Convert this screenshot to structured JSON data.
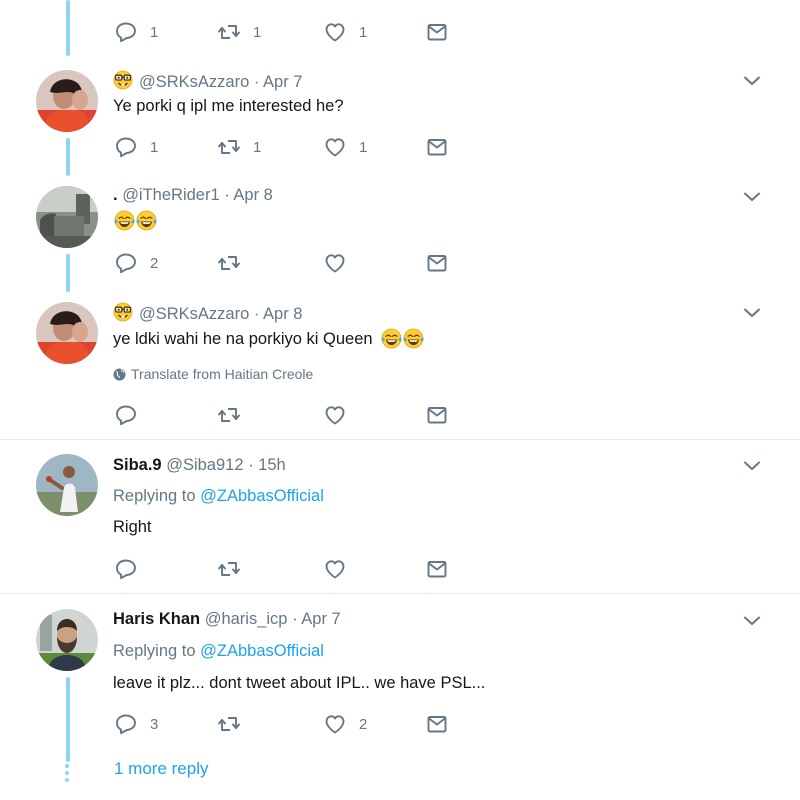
{
  "tweets": [
    {
      "handle": "",
      "date": "",
      "text": "",
      "actions": {
        "reply": "1",
        "retweet": "1",
        "like": "1"
      }
    },
    {
      "name": "",
      "handle": "@SRKsAzzaro",
      "date": "· Apr 7",
      "text": "Ye porki q ipl me interested he?",
      "actions": {
        "reply": "1",
        "retweet": "1",
        "like": "1"
      }
    },
    {
      "name": ".",
      "handle": "@iTheRider1",
      "date": "· Apr 8",
      "text": "",
      "actions": {
        "reply": "2",
        "retweet": "",
        "like": ""
      }
    },
    {
      "name": "",
      "handle": "@SRKsAzzaro",
      "date": "· Apr 8",
      "text": "ye ldki wahi he na porkiyo ki Queen",
      "translate": "Translate from Haitian Creole",
      "actions": {
        "reply": "",
        "retweet": "",
        "like": ""
      }
    },
    {
      "name": "Siba.9",
      "handle": "@Siba912",
      "date": "· 15h",
      "replying_prefix": "Replying to",
      "replying_to": "@ZAbbasOfficial",
      "text": "Right",
      "actions": {
        "reply": "",
        "retweet": "",
        "like": ""
      }
    },
    {
      "name": "Haris Khan",
      "handle": "@haris_icp",
      "date": "· Apr 7",
      "replying_prefix": "Replying to",
      "replying_to": "@ZAbbasOfficial",
      "text": "leave it plz... dont tweet about IPL.. we have PSL...",
      "actions": {
        "reply": "3",
        "retweet": "",
        "like": "2"
      }
    }
  ],
  "more_reply": "1 more reply",
  "icons": {
    "reply": "reply-icon",
    "retweet": "retweet-icon",
    "like": "heart-icon",
    "dm": "envelope-icon",
    "caret": "chevron-down-icon",
    "globe": "globe-icon",
    "emoji_laugh": "tears-of-joy-emoji",
    "emoji_nerd": "nerd-face-emoji"
  },
  "colors": {
    "link": "#1da1f2",
    "muted": "#657786",
    "thread": "#8fd4f5",
    "divider": "#e6ecf0"
  }
}
